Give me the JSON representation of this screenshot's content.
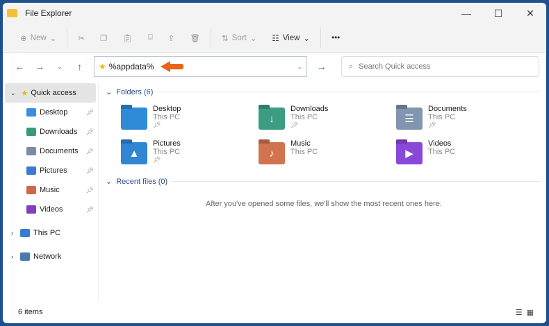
{
  "window": {
    "title": "File Explorer"
  },
  "toolbar": {
    "new": "New",
    "sort": "Sort",
    "view": "View",
    "more": "•••"
  },
  "address": {
    "value": "%appdata%",
    "search_placeholder": "Search Quick access"
  },
  "sidebar": {
    "quick_access": "Quick access",
    "items": [
      {
        "label": "Desktop",
        "color": "#3a8ee0"
      },
      {
        "label": "Downloads",
        "color": "#3a9a7a"
      },
      {
        "label": "Documents",
        "color": "#7a8aa8"
      },
      {
        "label": "Pictures",
        "color": "#3a7ad0"
      },
      {
        "label": "Music",
        "color": "#d06848"
      },
      {
        "label": "Videos",
        "color": "#8040c0"
      }
    ],
    "this_pc": "This PC",
    "network": "Network"
  },
  "main": {
    "folders_header": "Folders (6)",
    "folders": [
      {
        "name": "Desktop",
        "loc": "This PC",
        "pinned": true,
        "color": "#2f8ad8",
        "glyph": ""
      },
      {
        "name": "Downloads",
        "loc": "This PC",
        "pinned": true,
        "color": "#3c9d83",
        "glyph": "↓"
      },
      {
        "name": "Documents",
        "loc": "This PC",
        "pinned": true,
        "color": "#8194b0",
        "glyph": "☰"
      },
      {
        "name": "Pictures",
        "loc": "This PC",
        "pinned": true,
        "color": "#3186d3",
        "glyph": "▲"
      },
      {
        "name": "Music",
        "loc": "This PC",
        "pinned": false,
        "color": "#d2734f",
        "glyph": "♪"
      },
      {
        "name": "Videos",
        "loc": "This PC",
        "pinned": false,
        "color": "#8a48d8",
        "glyph": "▶"
      }
    ],
    "recent_header": "Recent files (0)",
    "empty_text": "After you've opened some files, we'll show the most recent ones here."
  },
  "status": {
    "count": "6 items"
  }
}
